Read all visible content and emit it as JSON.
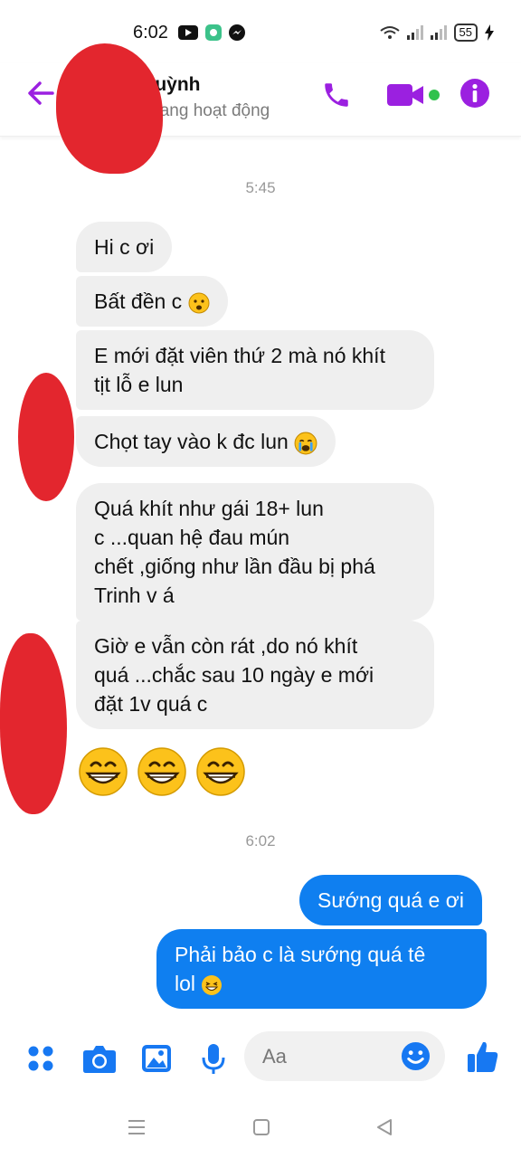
{
  "status_bar": {
    "time": "6:02",
    "battery": "55"
  },
  "header": {
    "contact_name": "Quỳnh",
    "contact_status": "Đang hoạt động"
  },
  "messages": {
    "timestamp_1": "5:45",
    "m1": "Hi c ơi",
    "m2": "Bất đền c",
    "m3_line1": "E mới đặt viên thứ 2 mà nó khít",
    "m3_line2": "tịt lỗ e lun",
    "m4": "Chọt tay vào k đc lun",
    "m5_line1": "Quá khít như gái 18+ lun",
    "m5_line2": "c ...quan hệ đau mún",
    "m5_line3": "chết ,giống như lần đầu bị phá",
    "m5_line4": "Trinh v á",
    "m6_line1": "Giờ e vẫn còn rát ,do nó khít",
    "m6_line2": "quá ...chắc sau 10 ngày e mới",
    "m6_line3": "đặt 1v quá c",
    "timestamp_2": "6:02",
    "m7": "Sướng quá e ơi",
    "m8_line1": "Phải bảo c là sướng quá tê",
    "m8_line2": "lol"
  },
  "composer": {
    "placeholder": "Aa"
  },
  "colors": {
    "accent": "#9b20e0",
    "outgoing": "#0f7ff0",
    "incoming": "#efefef",
    "icon_blue": "#1778f2"
  }
}
